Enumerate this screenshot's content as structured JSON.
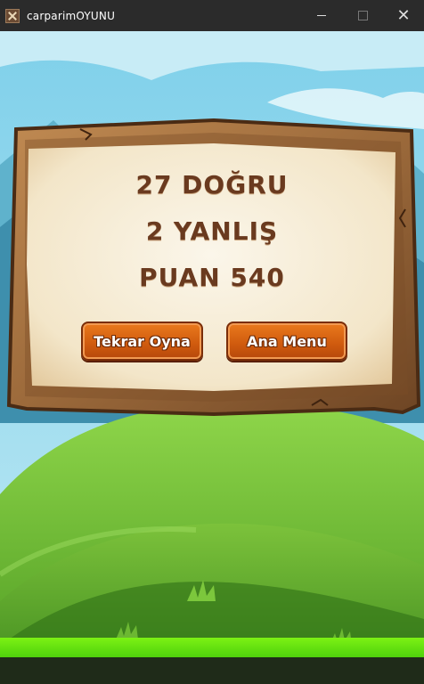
{
  "window": {
    "title": "carparimOYUNU",
    "icon": "game-app-icon",
    "controls": {
      "minimize": "minimize-icon",
      "maximize": "maximize-icon",
      "close": "close-icon"
    }
  },
  "result": {
    "correct_text": "27 DOĞRU",
    "wrong_text": "2 YANLIŞ",
    "score_text": "PUAN 540"
  },
  "buttons": {
    "replay_label": "Tekrar Oyna",
    "menu_label": "Ana Menu"
  },
  "colors": {
    "sky": "#8fd3e8",
    "grass": "#6ab42f",
    "text_brown": "#6a3a1f",
    "button_orange": "#d6620f"
  }
}
